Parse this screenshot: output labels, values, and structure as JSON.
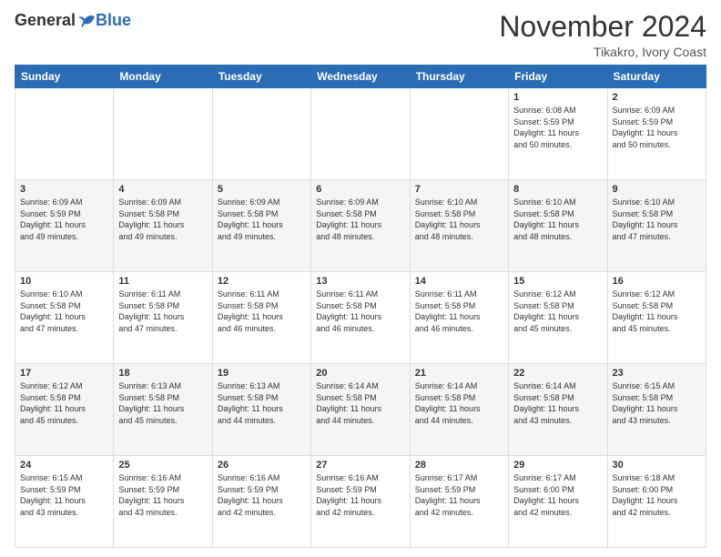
{
  "header": {
    "logo_general": "General",
    "logo_blue": "Blue",
    "month_title": "November 2024",
    "location": "Tikakro, Ivory Coast"
  },
  "weekdays": [
    "Sunday",
    "Monday",
    "Tuesday",
    "Wednesday",
    "Thursday",
    "Friday",
    "Saturday"
  ],
  "weeks": [
    [
      {
        "day": "",
        "detail": ""
      },
      {
        "day": "",
        "detail": ""
      },
      {
        "day": "",
        "detail": ""
      },
      {
        "day": "",
        "detail": ""
      },
      {
        "day": "",
        "detail": ""
      },
      {
        "day": "1",
        "detail": "Sunrise: 6:08 AM\nSunset: 5:59 PM\nDaylight: 11 hours\nand 50 minutes."
      },
      {
        "day": "2",
        "detail": "Sunrise: 6:09 AM\nSunset: 5:59 PM\nDaylight: 11 hours\nand 50 minutes."
      }
    ],
    [
      {
        "day": "3",
        "detail": "Sunrise: 6:09 AM\nSunset: 5:59 PM\nDaylight: 11 hours\nand 49 minutes."
      },
      {
        "day": "4",
        "detail": "Sunrise: 6:09 AM\nSunset: 5:58 PM\nDaylight: 11 hours\nand 49 minutes."
      },
      {
        "day": "5",
        "detail": "Sunrise: 6:09 AM\nSunset: 5:58 PM\nDaylight: 11 hours\nand 49 minutes."
      },
      {
        "day": "6",
        "detail": "Sunrise: 6:09 AM\nSunset: 5:58 PM\nDaylight: 11 hours\nand 48 minutes."
      },
      {
        "day": "7",
        "detail": "Sunrise: 6:10 AM\nSunset: 5:58 PM\nDaylight: 11 hours\nand 48 minutes."
      },
      {
        "day": "8",
        "detail": "Sunrise: 6:10 AM\nSunset: 5:58 PM\nDaylight: 11 hours\nand 48 minutes."
      },
      {
        "day": "9",
        "detail": "Sunrise: 6:10 AM\nSunset: 5:58 PM\nDaylight: 11 hours\nand 47 minutes."
      }
    ],
    [
      {
        "day": "10",
        "detail": "Sunrise: 6:10 AM\nSunset: 5:58 PM\nDaylight: 11 hours\nand 47 minutes."
      },
      {
        "day": "11",
        "detail": "Sunrise: 6:11 AM\nSunset: 5:58 PM\nDaylight: 11 hours\nand 47 minutes."
      },
      {
        "day": "12",
        "detail": "Sunrise: 6:11 AM\nSunset: 5:58 PM\nDaylight: 11 hours\nand 46 minutes."
      },
      {
        "day": "13",
        "detail": "Sunrise: 6:11 AM\nSunset: 5:58 PM\nDaylight: 11 hours\nand 46 minutes."
      },
      {
        "day": "14",
        "detail": "Sunrise: 6:11 AM\nSunset: 5:58 PM\nDaylight: 11 hours\nand 46 minutes."
      },
      {
        "day": "15",
        "detail": "Sunrise: 6:12 AM\nSunset: 5:58 PM\nDaylight: 11 hours\nand 45 minutes."
      },
      {
        "day": "16",
        "detail": "Sunrise: 6:12 AM\nSunset: 5:58 PM\nDaylight: 11 hours\nand 45 minutes."
      }
    ],
    [
      {
        "day": "17",
        "detail": "Sunrise: 6:12 AM\nSunset: 5:58 PM\nDaylight: 11 hours\nand 45 minutes."
      },
      {
        "day": "18",
        "detail": "Sunrise: 6:13 AM\nSunset: 5:58 PM\nDaylight: 11 hours\nand 45 minutes."
      },
      {
        "day": "19",
        "detail": "Sunrise: 6:13 AM\nSunset: 5:58 PM\nDaylight: 11 hours\nand 44 minutes."
      },
      {
        "day": "20",
        "detail": "Sunrise: 6:14 AM\nSunset: 5:58 PM\nDaylight: 11 hours\nand 44 minutes."
      },
      {
        "day": "21",
        "detail": "Sunrise: 6:14 AM\nSunset: 5:58 PM\nDaylight: 11 hours\nand 44 minutes."
      },
      {
        "day": "22",
        "detail": "Sunrise: 6:14 AM\nSunset: 5:58 PM\nDaylight: 11 hours\nand 43 minutes."
      },
      {
        "day": "23",
        "detail": "Sunrise: 6:15 AM\nSunset: 5:58 PM\nDaylight: 11 hours\nand 43 minutes."
      }
    ],
    [
      {
        "day": "24",
        "detail": "Sunrise: 6:15 AM\nSunset: 5:59 PM\nDaylight: 11 hours\nand 43 minutes."
      },
      {
        "day": "25",
        "detail": "Sunrise: 6:16 AM\nSunset: 5:59 PM\nDaylight: 11 hours\nand 43 minutes."
      },
      {
        "day": "26",
        "detail": "Sunrise: 6:16 AM\nSunset: 5:59 PM\nDaylight: 11 hours\nand 42 minutes."
      },
      {
        "day": "27",
        "detail": "Sunrise: 6:16 AM\nSunset: 5:59 PM\nDaylight: 11 hours\nand 42 minutes."
      },
      {
        "day": "28",
        "detail": "Sunrise: 6:17 AM\nSunset: 5:59 PM\nDaylight: 11 hours\nand 42 minutes."
      },
      {
        "day": "29",
        "detail": "Sunrise: 6:17 AM\nSunset: 6:00 PM\nDaylight: 11 hours\nand 42 minutes."
      },
      {
        "day": "30",
        "detail": "Sunrise: 6:18 AM\nSunset: 6:00 PM\nDaylight: 11 hours\nand 42 minutes."
      }
    ]
  ]
}
